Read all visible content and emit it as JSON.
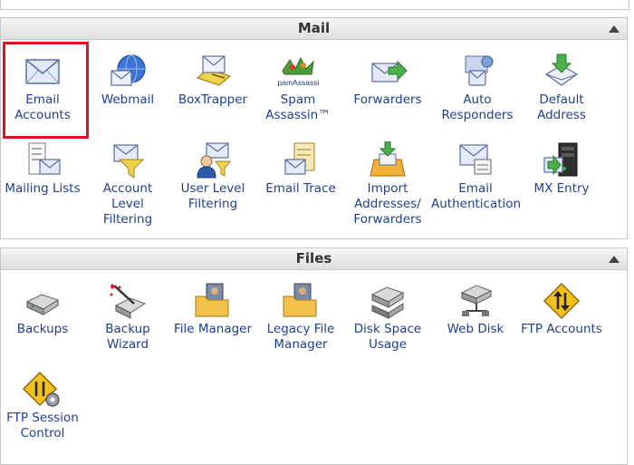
{
  "mail": {
    "title": "Mail",
    "items": [
      {
        "label": "Email Accounts",
        "icon": "envelope-icon"
      },
      {
        "label": "Webmail",
        "icon": "globe-envelope-icon"
      },
      {
        "label": "BoxTrapper",
        "icon": "boxtrapper-icon"
      },
      {
        "label": "Spam Assassin™",
        "icon": "spamassassin-icon",
        "logo_text": "SpamAssassin"
      },
      {
        "label": "Forwarders",
        "icon": "forward-arrow-envelope-icon"
      },
      {
        "label": "Auto Responders",
        "icon": "auto-responder-icon"
      },
      {
        "label": "Default Address",
        "icon": "default-address-icon"
      },
      {
        "label": "Mailing Lists",
        "icon": "mailing-list-icon"
      },
      {
        "label": "Account Level Filtering",
        "icon": "funnel-envelope-icon"
      },
      {
        "label": "User Level Filtering",
        "icon": "user-funnel-icon"
      },
      {
        "label": "Email Trace",
        "icon": "trace-document-icon"
      },
      {
        "label": "Import Addresses/ Forwarders",
        "icon": "import-box-icon"
      },
      {
        "label": "Email Authentication",
        "icon": "authentication-envelope-icon"
      },
      {
        "label": "MX Entry",
        "icon": "mx-server-icon"
      }
    ]
  },
  "files": {
    "title": "Files",
    "items": [
      {
        "label": "Backups",
        "icon": "disk-drive-icon"
      },
      {
        "label": "Backup Wizard",
        "icon": "backup-wizard-icon"
      },
      {
        "label": "File Manager",
        "icon": "folder-icon"
      },
      {
        "label": "Legacy File Manager",
        "icon": "legacy-folder-icon"
      },
      {
        "label": "Disk Space Usage",
        "icon": "disk-usage-icon"
      },
      {
        "label": "Web Disk",
        "icon": "web-disk-icon"
      },
      {
        "label": "FTP Accounts",
        "icon": "ftp-sign-icon"
      },
      {
        "label": "FTP Session Control",
        "icon": "ftp-gear-icon"
      }
    ]
  },
  "colors": {
    "link": "#1f3f8e",
    "highlight": "#e0121b",
    "header_text": "#333333"
  }
}
